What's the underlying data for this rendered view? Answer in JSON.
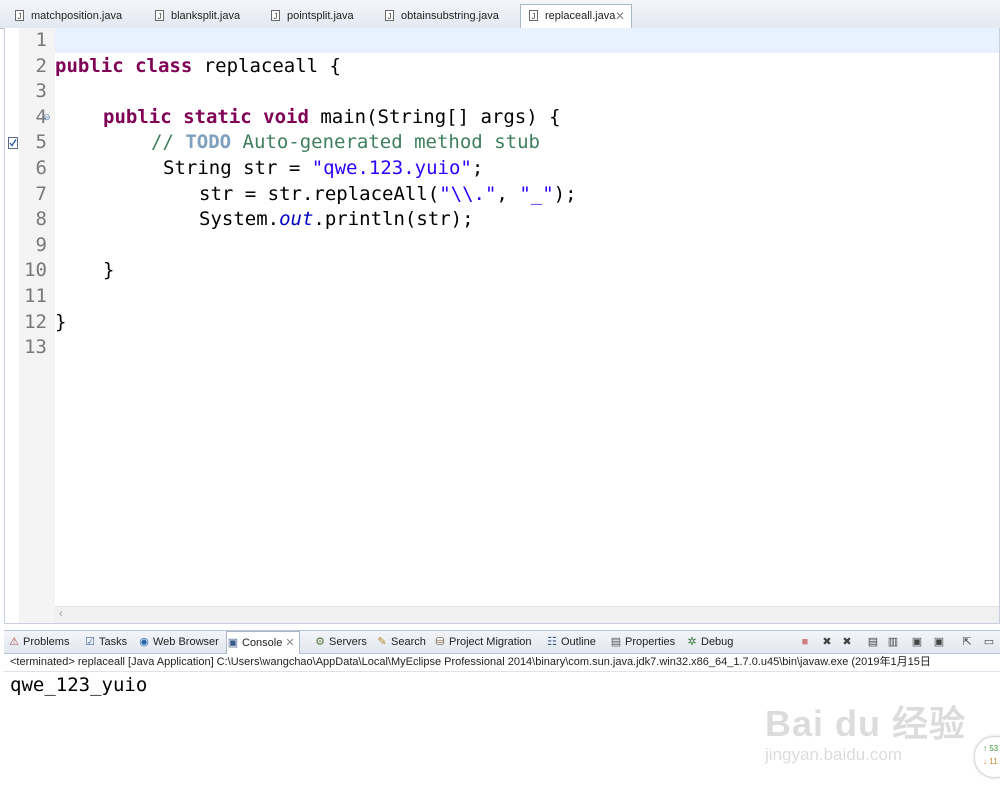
{
  "editor_tabs": [
    {
      "label": "matchposition.java",
      "active": false
    },
    {
      "label": "blanksplit.java",
      "active": false
    },
    {
      "label": "pointsplit.java",
      "active": false
    },
    {
      "label": "obtainsubstring.java",
      "active": false
    },
    {
      "label": "replaceall.java",
      "active": true
    }
  ],
  "close_glyph": "✕",
  "line_numbers": [
    "1",
    "2",
    "3",
    "4",
    "5",
    "6",
    "7",
    "8",
    "9",
    "10",
    "11",
    "12",
    "13"
  ],
  "code": {
    "l2": {
      "kw": "public class",
      "rest": " replaceall {"
    },
    "l4": {
      "kw": "public static void",
      "rest": " main(String[] args) {"
    },
    "l5": {
      "comment": "// ",
      "todo": "TODO",
      "comment_rest": " Auto-generated method stub"
    },
    "l6": {
      "pre": "String str = ",
      "str": "\"qwe.123.yuio\"",
      "post": ";"
    },
    "l7": {
      "pre": "str = str.replaceAll(",
      "str1": "\"\\\\.\"",
      "mid": ", ",
      "str2": "\"_\"",
      "post": ");"
    },
    "l8": {
      "pre": "System.",
      "static": "out",
      "post": ".println(str);"
    },
    "l10": "}",
    "l12": "}"
  },
  "views": [
    {
      "label": "Problems",
      "icon": "problems-icon",
      "glyph": "⚠"
    },
    {
      "label": "Tasks",
      "icon": "tasks-icon",
      "glyph": "☑"
    },
    {
      "label": "Web Browser",
      "icon": "globe-icon",
      "glyph": "◉"
    },
    {
      "label": "Console",
      "icon": "console-icon",
      "glyph": "▣",
      "active": true
    },
    {
      "label": "Servers",
      "icon": "servers-icon",
      "glyph": "⚙"
    },
    {
      "label": "Search",
      "icon": "search-icon",
      "glyph": "✎"
    },
    {
      "label": "Project Migration",
      "icon": "migration-icon",
      "glyph": "⛁"
    },
    {
      "label": "Outline",
      "icon": "outline-icon",
      "glyph": "☷"
    },
    {
      "label": "Properties",
      "icon": "properties-icon",
      "glyph": "▤"
    },
    {
      "label": "Debug",
      "icon": "debug-icon",
      "glyph": "✲"
    }
  ],
  "console": {
    "header": "<terminated> replaceall [Java Application] C:\\Users\\wangchao\\AppData\\Local\\MyEclipse Professional 2014\\binary\\com.sun.java.jdk7.win32.x86_64_1.7.0.u45\\bin\\javaw.exe (2019年1月15日",
    "output": "qwe_123_yuio"
  },
  "watermark": {
    "main": "Bai du 经验",
    "sub": "jingyan.baidu.com"
  },
  "side_widget": {
    "up": "53",
    "down": "11"
  },
  "colors": {
    "keyword": "#7f0055",
    "string": "#2a00ff",
    "comment": "#3f7f5f",
    "static_field": "#0000c0",
    "current_line": "#e8f2fe"
  }
}
